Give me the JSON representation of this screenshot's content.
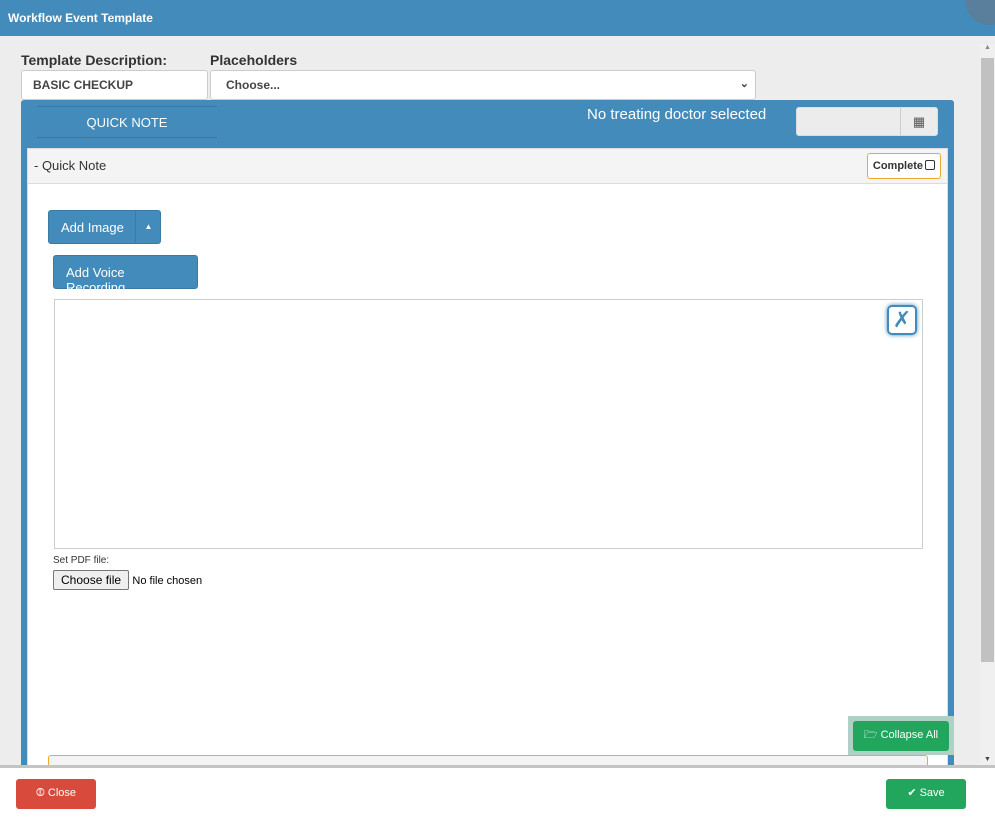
{
  "window": {
    "title": "Workflow Event Template"
  },
  "form": {
    "template_description_label": "Template Description:",
    "template_description_value": "BASIC CHECKUP",
    "placeholders_label": "Placeholders",
    "placeholders_selected": "Choose..."
  },
  "panel": {
    "tab_label": "QUICK NOTE",
    "doctor_status": "No treating doctor selected",
    "date_value": "",
    "section": {
      "title": "- Quick Note",
      "complete_label": "Complete",
      "complete_checked": false
    },
    "add_image_label": "Add Image",
    "add_voice_label": "Add Voice Recording",
    "pdf_label": "Set PDF file:",
    "choose_file_label": "Choose file",
    "no_file_text": "No file chosen",
    "collapse_all_label": "Collapse All"
  },
  "footer": {
    "close_label": "Close",
    "save_label": "Save"
  },
  "colors": {
    "primary": "#428bba",
    "success": "#22a55c",
    "danger": "#d84b3c",
    "warning": "#f0a830"
  }
}
